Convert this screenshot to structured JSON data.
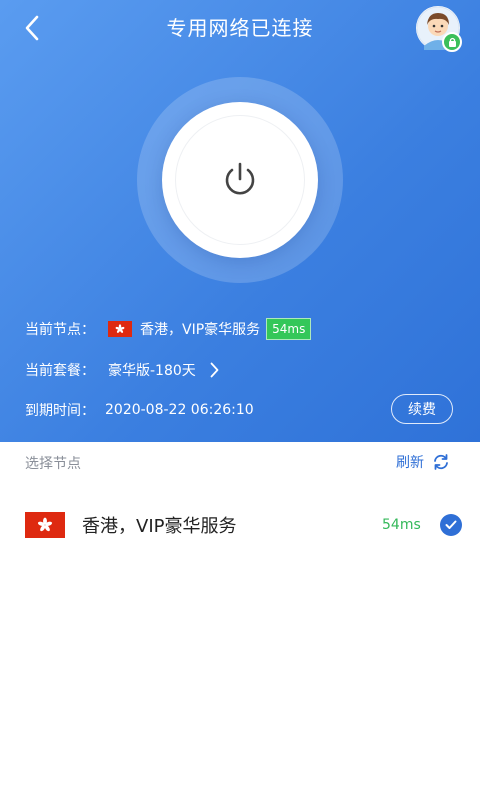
{
  "header": {
    "title": "专用网络已连接",
    "back_icon": "chevron-left-icon",
    "avatar_icon": "user-avatar",
    "lock_icon": "lock-icon"
  },
  "status": {
    "connected": true,
    "power_icon": "power-icon"
  },
  "info": {
    "current_node_label": "当前节点：",
    "current_node_value": "香港，VIP豪华服务",
    "current_node_latency": "54ms",
    "current_plan_label": "当前套餐：",
    "current_plan_value": "豪华版-180天",
    "expiry_label": "到期时间：",
    "expiry_value": "2020-08-22 06:26:10",
    "renew_label": "续费"
  },
  "nodes": {
    "section_title": "选择节点",
    "refresh_label": "刷新",
    "items": [
      {
        "name": "香港，VIP豪华服务",
        "latency": "54ms",
        "selected": true
      }
    ]
  },
  "colors": {
    "primary": "#3b7fe0",
    "latency_green": "#34c759",
    "flag_red": "#de2910"
  }
}
